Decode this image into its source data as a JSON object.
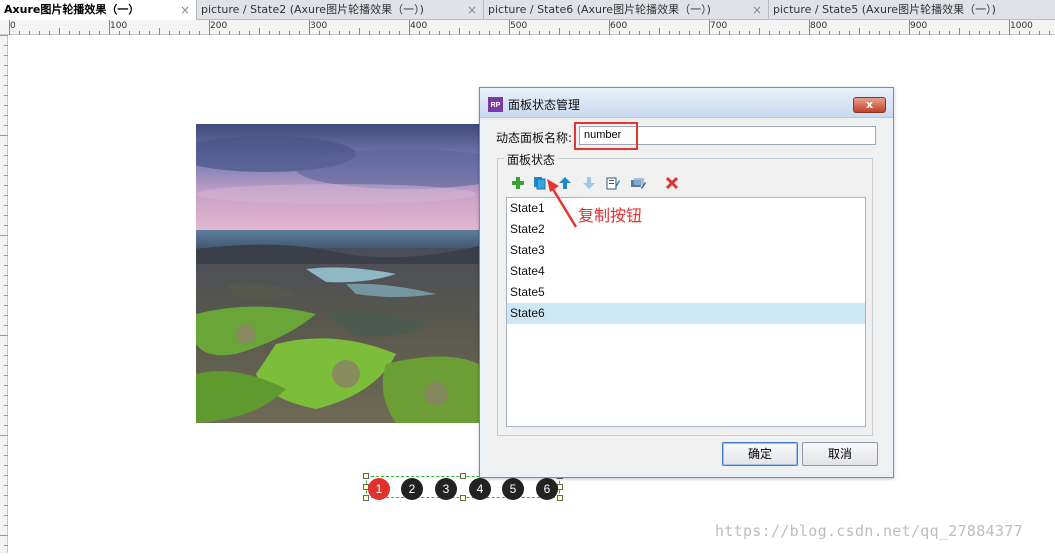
{
  "tabs": [
    {
      "label": "Axure图片轮播效果（一）",
      "active": true
    },
    {
      "label": "picture / State2 (Axure图片轮播效果（一）)",
      "active": false
    },
    {
      "label": "picture / State6 (Axure图片轮播效果（一）)",
      "active": false
    },
    {
      "label": "picture / State5 (Axure图片轮播效果（一）)",
      "active": false
    }
  ],
  "tab_close": "×",
  "ruler": {
    "labels": [
      "0",
      "100",
      "200",
      "300",
      "400",
      "500",
      "600",
      "700",
      "800",
      "900",
      "1000"
    ]
  },
  "dots": [
    "1",
    "2",
    "3",
    "4",
    "5",
    "6"
  ],
  "dialog": {
    "title": "面板状态管理",
    "app_icon": "RP",
    "close_icon": "x",
    "name_label": "动态面板名称:",
    "name_value": "number",
    "group_label": "面板状态",
    "toolbar": {
      "add_icon": "+",
      "duplicate_icon": "copy",
      "move_up_icon": "↑",
      "move_down_icon": "↓",
      "edit_icon": "edit",
      "edit_all_icon": "edit-all",
      "delete_icon": "✖"
    },
    "states": [
      "State1",
      "State2",
      "State3",
      "State4",
      "State5",
      "State6"
    ],
    "selected_state": "State6",
    "ok_label": "确定",
    "cancel_label": "取消"
  },
  "annotation": "复制按钮",
  "watermark": "https://blog.csdn.net/qq_27884377",
  "colors": {
    "accent_red": "#e3342f",
    "selection": "#cde7f7",
    "dot_active": "#e0312f",
    "dot": "#222222"
  }
}
